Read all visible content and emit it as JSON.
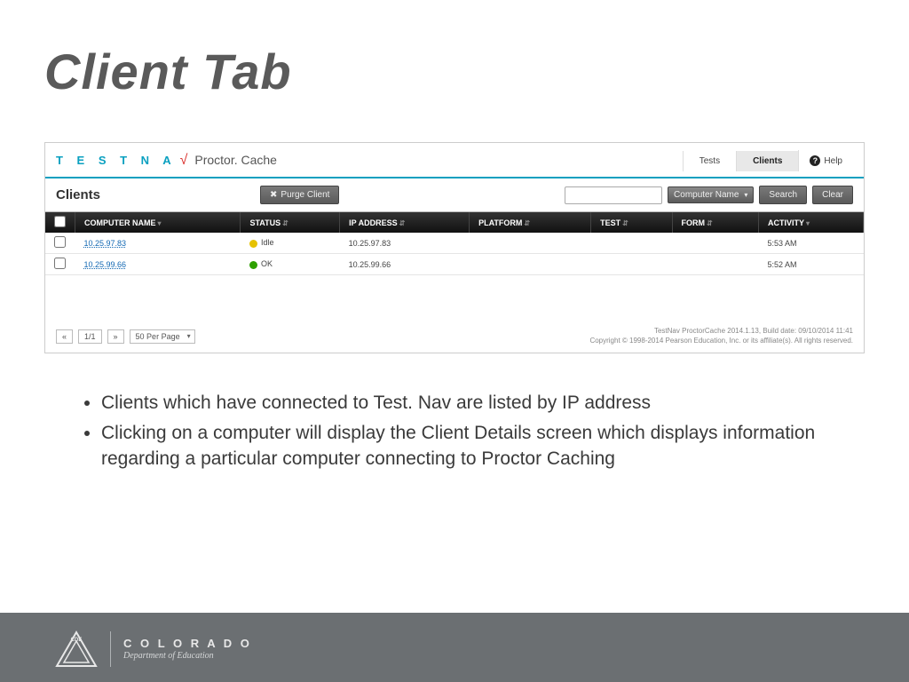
{
  "slide": {
    "title": "Client Tab"
  },
  "app": {
    "logo_text": "T E S T N A",
    "logo_check": "√",
    "product": "Proctor. Cache",
    "nav": {
      "tests": "Tests",
      "clients": "Clients",
      "help": "Help"
    }
  },
  "toolbar": {
    "page_label": "Clients",
    "purge_btn": "Purge Client",
    "search_placeholder": "",
    "filter_selected": "Computer Name",
    "search_btn": "Search",
    "clear_btn": "Clear"
  },
  "table": {
    "columns": {
      "computer": "COMPUTER NAME",
      "status": "STATUS",
      "ip": "IP ADDRESS",
      "platform": "PLATFORM",
      "test": "TEST",
      "form": "FORM",
      "activity": "ACTIVITY"
    },
    "rows": [
      {
        "name": "10.25.97.83",
        "status_label": "Idle",
        "status_color": "yellow",
        "ip": "10.25.97.83",
        "platform": "",
        "test": "",
        "form": "",
        "activity": "5:53 AM"
      },
      {
        "name": "10.25.99.66",
        "status_label": "OK",
        "status_color": "green",
        "ip": "10.25.99.66",
        "platform": "",
        "test": "",
        "form": "",
        "activity": "5:52 AM"
      }
    ]
  },
  "pager": {
    "prev": "«",
    "current": "1/1",
    "next": "»",
    "per_page": "50 Per Page"
  },
  "meta": {
    "line1": "TestNav ProctorCache 2014.1.13, Build date: 09/10/2014 11:41",
    "line2": "Copyright © 1998-2014 Pearson Education, Inc. or its affiliate(s). All rights reserved."
  },
  "bullets": {
    "items": [
      "Clients which have connected to Test. Nav are listed by IP address",
      "Clicking on a computer will display the Client Details screen which displays information regarding a particular computer connecting to Proctor Caching"
    ]
  },
  "footer": {
    "state": "C O L O R A D O",
    "dept": "Department of Education"
  }
}
